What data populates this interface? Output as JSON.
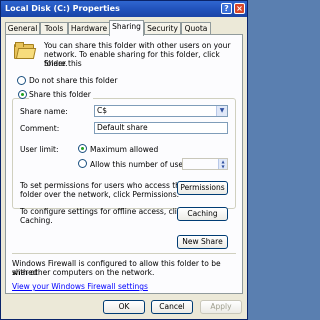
{
  "window": {
    "title": "Local Disk (C:) Properties",
    "help": "?",
    "close": "×"
  },
  "tabs": [
    "General",
    "Tools",
    "Hardware",
    "Sharing",
    "Security",
    "Quota"
  ],
  "intro": {
    "line1": "You can share this folder with other users on your",
    "line2": "network.  To enable sharing for this folder, click Share this",
    "line3": "folder."
  },
  "sharing": {
    "do_not_share": "Do not share this folder",
    "share": "Share this folder",
    "share_name_label": "Share name:",
    "share_name_value": "C$",
    "comment_label": "Comment:",
    "comment_value": "Default share",
    "user_limit_label": "User limit:",
    "maximum_allowed": "Maximum allowed",
    "allow_users": "Allow this number of users:"
  },
  "permissions": {
    "line1": "To set permissions for users who access this",
    "line2": "folder over the network, click Permissions.",
    "button": "Permissions"
  },
  "offline": {
    "line1": "To configure settings for offline access, click",
    "line2": "Caching.",
    "button": "Caching"
  },
  "new_share_button": "New Share",
  "firewall": {
    "line1": "Windows Firewall is configured to allow this folder to be shared",
    "line2": "with other computers on the network.",
    "link": "View your Windows Firewall settings"
  },
  "buttons": {
    "ok": "OK",
    "cancel": "Cancel",
    "apply": "Apply"
  }
}
